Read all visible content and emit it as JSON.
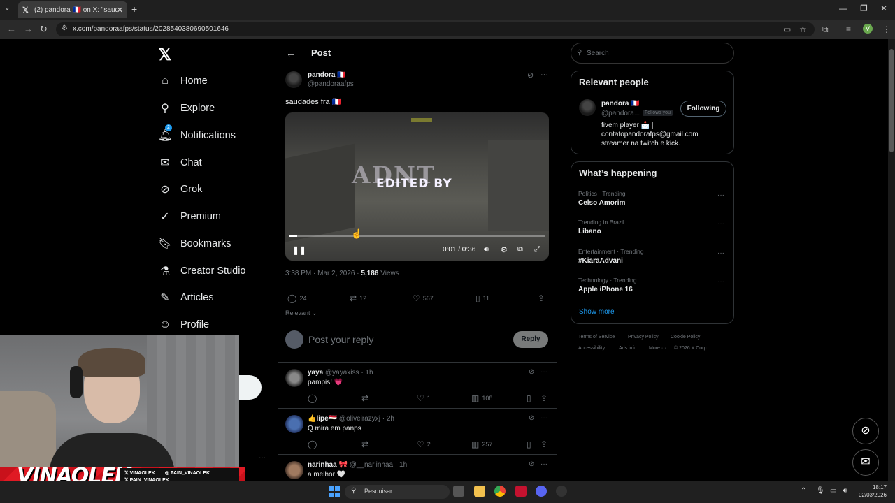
{
  "browser": {
    "tab_title": "(2) pandora 🇫🇷 on X: \"saudades",
    "url": "x.com/pandoraafps/status/2028540380690501646",
    "profile_initial": "V"
  },
  "nav": {
    "items": [
      {
        "label": "Home",
        "icon": "home-icon"
      },
      {
        "label": "Explore",
        "icon": "search-icon"
      },
      {
        "label": "Notifications",
        "icon": "bell-icon",
        "badge": "2"
      },
      {
        "label": "Chat",
        "icon": "mail-icon"
      },
      {
        "label": "Grok",
        "icon": "grok-icon"
      },
      {
        "label": "Premium",
        "icon": "verified-icon"
      },
      {
        "label": "Bookmarks",
        "icon": "bookmark-icon"
      },
      {
        "label": "Creator Studio",
        "icon": "flask-icon"
      },
      {
        "label": "Articles",
        "icon": "article-icon"
      },
      {
        "label": "Profile",
        "icon": "person-icon"
      }
    ],
    "more_dots": "···"
  },
  "post": {
    "header_title": "Post",
    "author_name": "pandora 🇫🇷",
    "author_handle": "@pandoraafps",
    "text": "saudades fra 🇫🇷",
    "video_overlay_text": "EDITED BY",
    "video_time": "0:01 / 0:36",
    "video_progress": 0.03,
    "timestamp": "3:38 PM · Mar 2, 2026 · ",
    "views_count": "5,186",
    "views_label": " Views",
    "replies": "24",
    "reposts": "12",
    "likes": "567",
    "bookmarks": "11",
    "sort_label": "Relevant",
    "reply_placeholder": "Post your reply",
    "reply_button": "Reply"
  },
  "replies": [
    {
      "name": "yaya",
      "handle": "@yayaxiss",
      "time": "· 1h",
      "text": "pampis! 💗",
      "reposts": "",
      "likes": "1",
      "views": "108"
    },
    {
      "name": "👍lipe🇪🇬",
      "handle": "@oliveirazyxj",
      "time": "· 2h",
      "text": "Q mira em panps",
      "reposts": "",
      "likes": "2",
      "views": "257"
    },
    {
      "name": "narinhaa 🎀",
      "handle": "@__nariinhaa",
      "time": "· 1h",
      "text": "a melhor 🤍"
    }
  ],
  "sidebar": {
    "search_placeholder": "Search",
    "relevant_title": "Relevant people",
    "relevant_name": "pandora 🇫🇷",
    "relevant_handle": "@pandora...",
    "follows_you": "Follows you",
    "following_button": "Following",
    "bio_line1": "fivem player 📩 |",
    "bio_line2": "contatopandorafps@gmail.com",
    "bio_line3": "streamer na twitch e kick.",
    "happening_title": "What’s happening",
    "trends": [
      {
        "category": "Politics · Trending",
        "name": "Celso Amorim"
      },
      {
        "category": "Trending in Brazil",
        "name": "Líbano"
      },
      {
        "category": "Entertainment · Trending",
        "name": "#KiaraAdvani"
      },
      {
        "category": "Technology · Trending",
        "name": "Apple iPhone 16"
      }
    ],
    "show_more": "Show more",
    "footer": [
      "Terms of Service",
      "Privacy Policy",
      "Cookie Policy",
      "Accessibility",
      "Ads info",
      "More ···",
      "© 2026 X Corp."
    ]
  },
  "overlay": {
    "banner_name": "VINAOLEK",
    "social1": "VINAOLEK",
    "social2": "PAIN_VINAOLEK",
    "social3": "PAIN_VINAOLEK"
  },
  "taskbar": {
    "search_placeholder": "Pesquisar",
    "time": "18:17",
    "date": "02/03/2026"
  }
}
